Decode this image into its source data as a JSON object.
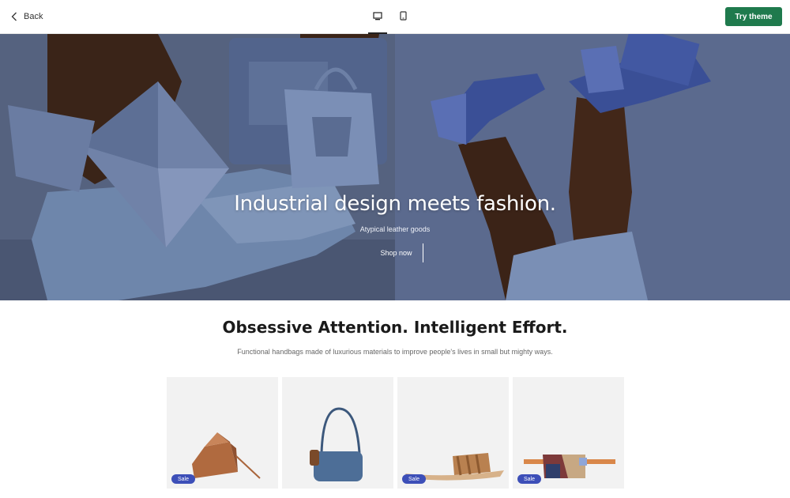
{
  "topbar": {
    "back_label": "Back",
    "device_modes": [
      "desktop",
      "mobile"
    ],
    "active_device": "desktop",
    "try_theme_label": "Try theme",
    "accent_color": "#1f7a4d"
  },
  "hero": {
    "title": "Industrial design meets fashion.",
    "subtitle": "Atypical leather goods",
    "cta_label": "Shop now"
  },
  "section": {
    "title": "Obsessive Attention. Intelligent Effort.",
    "description": "Functional handbags made of luxurious materials to improve people's lives in small but mighty ways."
  },
  "products": [
    {
      "badge": "Sale",
      "image": "tan-folded-crossbody-bag"
    },
    {
      "badge": "",
      "image": "blue-handbag-tortoise-handle"
    },
    {
      "badge": "Sale",
      "image": "striped-slide-sandal"
    },
    {
      "badge": "Sale",
      "image": "colorblock-belt-bag"
    }
  ],
  "colors": {
    "sale_badge": "#3d4fb8",
    "hero_bg": "#5b6a8e"
  }
}
